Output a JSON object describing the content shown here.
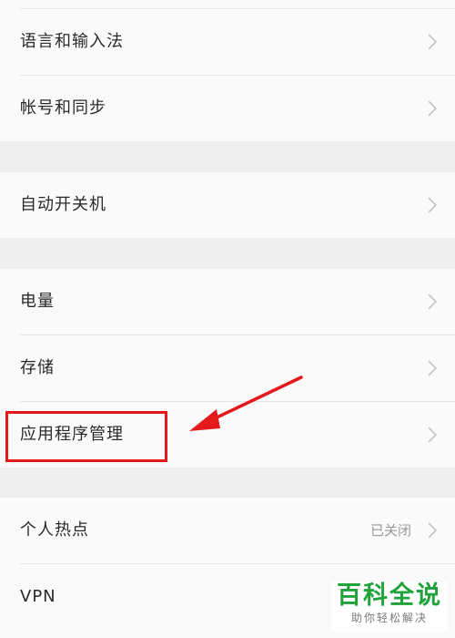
{
  "accent_red": "#e3191b",
  "groups": [
    {
      "items": [
        {
          "label": "语言和输入法",
          "value": "",
          "icon": "chevron-right-icon"
        },
        {
          "label": "帐号和同步",
          "value": "",
          "icon": "chevron-right-icon"
        }
      ]
    },
    {
      "items": [
        {
          "label": "自动开关机",
          "value": "",
          "icon": "chevron-right-icon"
        }
      ]
    },
    {
      "items": [
        {
          "label": "电量",
          "value": "",
          "icon": "chevron-right-icon"
        },
        {
          "label": "存储",
          "value": "",
          "icon": "chevron-right-icon"
        },
        {
          "label": "应用程序管理",
          "value": "",
          "icon": "chevron-right-icon"
        }
      ]
    },
    {
      "items": [
        {
          "label": "个人热点",
          "value": "已关闭",
          "icon": "chevron-right-icon"
        },
        {
          "label": "VPN",
          "value": "",
          "icon": "chevron-right-icon"
        }
      ]
    }
  ],
  "watermark": {
    "title": "百科全说",
    "subtitle": "助你轻松解决",
    "color": "#21a33c"
  }
}
